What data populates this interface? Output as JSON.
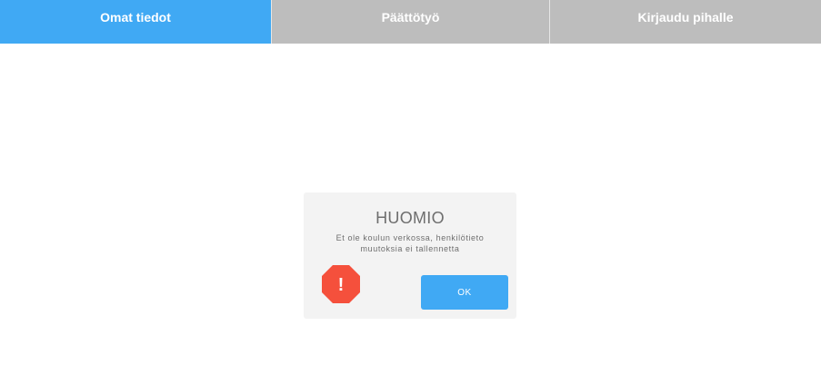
{
  "nav": {
    "tabs": [
      {
        "label": "Omat tiedot"
      },
      {
        "label": "Päättötyö"
      },
      {
        "label": "Kirjaudu pihalle"
      }
    ]
  },
  "dialog": {
    "title": "HUOMIO",
    "message_line1": "Et ole koulun verkossa, henkilötieto",
    "message_line2": "muutoksia ei tallennetta",
    "icon_glyph": "!",
    "ok_label": "OK"
  },
  "colors": {
    "accent": "#40a9f4",
    "tab_inactive": "#bdbdbd",
    "dialog_bg": "#f3f3f3",
    "warning": "#f5503c"
  },
  "icons": {
    "warning": "warning-octagon-icon"
  }
}
